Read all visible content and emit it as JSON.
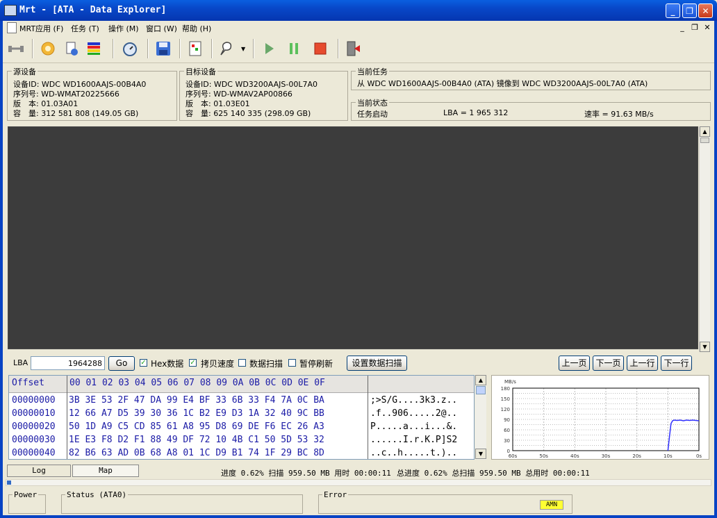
{
  "window": {
    "title": "Mrt - [ATA - Data Explorer]"
  },
  "menu": [
    "MRT应用 (F)",
    "任务 (T)",
    "操作 (M)",
    "窗口 (W)",
    "帮助 (H)"
  ],
  "source": {
    "title": "源设备",
    "lines": [
      "设备ID: WDC WD1600AAJS-00B4A0",
      "序列号: WD-WMAT20225666",
      "版　本: 01.03A01",
      "容　量: 312 581 808 (149.05 GB)"
    ]
  },
  "target": {
    "title": "目标设备",
    "lines": [
      "设备ID: WDC WD3200AAJS-00L7A0",
      "序列号: WD-WMAV2AP00866",
      "版　本: 01.03E01",
      "容　量: 625 140 335 (298.09 GB)"
    ]
  },
  "task": {
    "title": "当前任务",
    "text": "从 WDC WD1600AAJS-00B4A0 (ATA) 镜像到 WDC WD3200AAJS-00L7A0 (ATA)"
  },
  "state": {
    "title": "当前状态",
    "status": "任务启动",
    "lba": "LBA = 1 965 312",
    "rate": "速率 = 91.63 MB/s"
  },
  "controls": {
    "lba_label": "LBA",
    "lba_value": "1964288",
    "go": "Go",
    "hex_label": "Hex数据",
    "hex_checked": true,
    "copy_speed_label": "拷贝速度",
    "copy_speed_checked": true,
    "scan_label": "数据扫描",
    "scan_checked": false,
    "pause_refresh_label": "暂停刷新",
    "pause_refresh_checked": false,
    "set_scan": "设置数据扫描",
    "prev_page": "上一页",
    "next_page": "下一页",
    "prev_line": "上一行",
    "next_line": "下一行"
  },
  "hex": {
    "header_offset": "Offset",
    "header_bytes": "00 01 02 03 04 05 06 07 08 09 0A 0B 0C 0D 0E 0F",
    "rows": [
      {
        "offset": "00000000",
        "bytes": "3B 3E 53 2F 47 DA 99 E4 BF 33 6B 33 F4 7A 0C BA",
        "ascii": ";>S/G....3k3.z.."
      },
      {
        "offset": "00000010",
        "bytes": "12 66 A7 D5 39 30 36 1C B2 E9 D3 1A 32 40 9C BB",
        "ascii": ".f..906.....2@.."
      },
      {
        "offset": "00000020",
        "bytes": "50 1D A9 C5 CD 85 61 A8 95 D8 69 DE F6 EC 26 A3",
        "ascii": "P.....a...i...&."
      },
      {
        "offset": "00000030",
        "bytes": "1E E3 F8 D2 F1 88 49 DF 72 10 4B C1 50 5D 53 32",
        "ascii": "......I.r.K.P]S2"
      },
      {
        "offset": "00000040",
        "bytes": "82 B6 63 AD 0B 68 A8 01 1C D9 B1 74 1F 29 BC 8D",
        "ascii": "..c..h.....t.).."
      }
    ]
  },
  "chart_data": {
    "type": "line",
    "title": "",
    "ylabel": "MB/s",
    "xlabel": "",
    "y_ticks": [
      0,
      15,
      30,
      45,
      60,
      75,
      90,
      105,
      120,
      135,
      150,
      165,
      180
    ],
    "y_tick_labels": [
      "0",
      "30",
      "60",
      "90",
      "120",
      "150",
      "180"
    ],
    "x_tick_labels": [
      "60s",
      "50s",
      "40s",
      "30s",
      "20s",
      "10s",
      "0s"
    ],
    "ylim": [
      0,
      180
    ],
    "xlim": [
      60,
      0
    ],
    "grid": true,
    "series": [
      {
        "color": "#3030ff",
        "x": [
          10,
          9.5,
          9,
          8.5,
          8,
          7,
          6,
          5,
          4,
          3,
          2,
          1,
          0
        ],
        "y": [
          0,
          40,
          78,
          86,
          88,
          87,
          88,
          86,
          88,
          87,
          88,
          87,
          86
        ]
      }
    ]
  },
  "tabs": [
    "Log",
    "Map"
  ],
  "progress": {
    "text": "进度 0.62% 扫描 959.50 MB 用时 00:00:11",
    "total_text": "总进度 0.62% 总扫描 959.50 MB 总用时 00:00:11",
    "fraction": 0.0062
  },
  "status": {
    "power": "Power",
    "status": "Status (ATA0)",
    "error": "Error",
    "amn": "AMN"
  },
  "colors": {
    "map_ok": "#33cc33",
    "accent": "#0a5fe0"
  }
}
